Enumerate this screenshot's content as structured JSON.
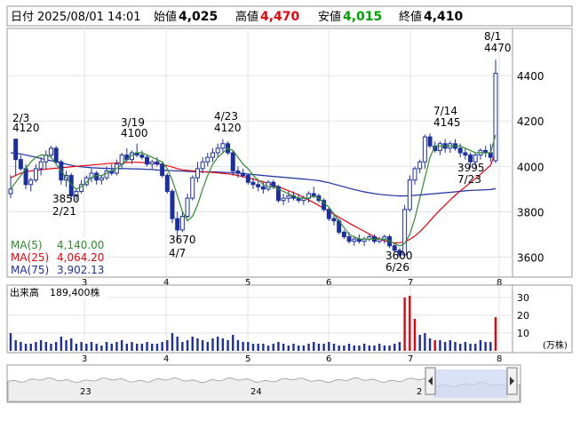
{
  "header": {
    "date_label": "日付",
    "date_value": "2025/08/01 14:01",
    "open_label": "始値",
    "open_value": "4,025",
    "high_label": "高値",
    "high_value": "4,470",
    "low_label": "安値",
    "low_value": "4,015",
    "close_label": "終値",
    "close_value": "4,410",
    "high_color": "#e8000b",
    "low_color": "#00a000"
  },
  "chart_data": [
    {
      "type": "candlestick",
      "ylim": [
        3520,
        4600
      ],
      "ticks": [
        3600,
        3800,
        4000,
        4200,
        4400
      ],
      "x_tick_labels": [
        "3",
        "4",
        "5",
        "6",
        "7",
        "8"
      ],
      "colors": {
        "up": "#ffffff",
        "down": "#1b2fa0",
        "ma5": "#2e8b2e",
        "ma25": "#e8000b",
        "ma75": "#1b2fa0"
      },
      "ohlc": [
        [
          3880,
          3860,
          3960,
          3900
        ],
        [
          4120,
          3960,
          4120,
          4030
        ],
        [
          4030,
          3980,
          4050,
          3990
        ],
        [
          3990,
          3900,
          4010,
          3920
        ],
        [
          3920,
          3890,
          3950,
          3940
        ],
        [
          3940,
          3930,
          4010,
          3990
        ],
        [
          3990,
          3960,
          4040,
          4020
        ],
        [
          4020,
          3990,
          4070,
          4050
        ],
        [
          4050,
          4040,
          4090,
          4080
        ],
        [
          4080,
          4010,
          4090,
          4020
        ],
        [
          4020,
          3920,
          4030,
          3940
        ],
        [
          3940,
          3910,
          3980,
          3960
        ],
        [
          3960,
          3850,
          3970,
          3870
        ],
        [
          3870,
          3850,
          3900,
          3890
        ],
        [
          3890,
          3880,
          3940,
          3920
        ],
        [
          3920,
          3910,
          3960,
          3950
        ],
        [
          3950,
          3930,
          3990,
          3970
        ],
        [
          3970,
          3920,
          3980,
          3940
        ],
        [
          3940,
          3920,
          3960,
          3950
        ],
        [
          3950,
          3940,
          4000,
          3980
        ],
        [
          3980,
          3960,
          4010,
          3970
        ],
        [
          3970,
          3960,
          4030,
          4010
        ],
        [
          4010,
          3990,
          4060,
          4050
        ],
        [
          4050,
          4020,
          4080,
          4030
        ],
        [
          4030,
          4010,
          4070,
          4060
        ],
        [
          4060,
          4040,
          4100,
          4050
        ],
        [
          4050,
          4030,
          4070,
          4040
        ],
        [
          4040,
          4000,
          4050,
          4010
        ],
        [
          4010,
          3990,
          4030,
          4020
        ],
        [
          4020,
          4000,
          4040,
          4010
        ],
        [
          4010,
          3950,
          4020,
          3960
        ],
        [
          3960,
          3880,
          3970,
          3890
        ],
        [
          3890,
          3750,
          3900,
          3770
        ],
        [
          3770,
          3670,
          3800,
          3720
        ],
        [
          3720,
          3710,
          3800,
          3780
        ],
        [
          3780,
          3770,
          3880,
          3860
        ],
        [
          3860,
          3850,
          3960,
          3950
        ],
        [
          3950,
          3930,
          4020,
          3990
        ],
        [
          3990,
          3970,
          4040,
          4020
        ],
        [
          4020,
          4000,
          4060,
          4040
        ],
        [
          4040,
          4020,
          4080,
          4060
        ],
        [
          4060,
          4040,
          4100,
          4080
        ],
        [
          4080,
          4060,
          4120,
          4100
        ],
        [
          4100,
          4050,
          4110,
          4060
        ],
        [
          4060,
          3960,
          4070,
          3980
        ],
        [
          3980,
          3950,
          4000,
          3970
        ],
        [
          3970,
          3950,
          3990,
          3960
        ],
        [
          3960,
          3920,
          3970,
          3930
        ],
        [
          3930,
          3900,
          3950,
          3920
        ],
        [
          3920,
          3890,
          3940,
          3910
        ],
        [
          3910,
          3880,
          3930,
          3900
        ],
        [
          3900,
          3890,
          3940,
          3930
        ],
        [
          3930,
          3900,
          3940,
          3910
        ],
        [
          3910,
          3840,
          3920,
          3850
        ],
        [
          3850,
          3830,
          3880,
          3860
        ],
        [
          3860,
          3840,
          3890,
          3870
        ],
        [
          3870,
          3850,
          3890,
          3860
        ],
        [
          3860,
          3840,
          3880,
          3850
        ],
        [
          3850,
          3830,
          3870,
          3860
        ],
        [
          3860,
          3840,
          3890,
          3880
        ],
        [
          3880,
          3860,
          3910,
          3870
        ],
        [
          3870,
          3840,
          3880,
          3850
        ],
        [
          3850,
          3800,
          3860,
          3810
        ],
        [
          3810,
          3760,
          3820,
          3770
        ],
        [
          3770,
          3740,
          3790,
          3760
        ],
        [
          3760,
          3700,
          3770,
          3710
        ],
        [
          3710,
          3680,
          3720,
          3690
        ],
        [
          3690,
          3660,
          3710,
          3670
        ],
        [
          3670,
          3650,
          3690,
          3680
        ],
        [
          3680,
          3660,
          3700,
          3670
        ],
        [
          3670,
          3650,
          3690,
          3680
        ],
        [
          3680,
          3670,
          3700,
          3690
        ],
        [
          3690,
          3660,
          3700,
          3670
        ],
        [
          3670,
          3660,
          3690,
          3680
        ],
        [
          3680,
          3660,
          3700,
          3690
        ],
        [
          3690,
          3640,
          3700,
          3650
        ],
        [
          3650,
          3620,
          3660,
          3630
        ],
        [
          3630,
          3600,
          3640,
          3610
        ],
        [
          3610,
          3600,
          3830,
          3810
        ],
        [
          3810,
          3800,
          3960,
          3940
        ],
        [
          3940,
          3920,
          4000,
          3990
        ],
        [
          3990,
          3970,
          4030,
          4020
        ],
        [
          4020,
          3990,
          4140,
          4130
        ],
        [
          4130,
          4080,
          4145,
          4090
        ],
        [
          4090,
          4060,
          4110,
          4070
        ],
        [
          4070,
          4050,
          4110,
          4100
        ],
        [
          4100,
          4060,
          4120,
          4080
        ],
        [
          4080,
          4060,
          4110,
          4100
        ],
        [
          4100,
          4070,
          4120,
          4080
        ],
        [
          4080,
          4040,
          4100,
          4060
        ],
        [
          4060,
          4030,
          4080,
          4050
        ],
        [
          4050,
          3995,
          4060,
          4020
        ],
        [
          4020,
          4000,
          4060,
          4050
        ],
        [
          4050,
          4030,
          4080,
          4070
        ],
        [
          4070,
          4040,
          4090,
          4060
        ],
        [
          4060,
          4020,
          4100,
          4040
        ],
        [
          4025,
          4015,
          4470,
          4410
        ]
      ],
      "ma5": [
        3900,
        3930,
        3960,
        3990,
        4020,
        4040,
        4050,
        4050,
        4040,
        4010,
        3980,
        3950,
        3920,
        3900,
        3910,
        3930,
        3950,
        3960,
        3960,
        3970,
        3980,
        3990,
        4010,
        4030,
        4050,
        4060,
        4060,
        4050,
        4040,
        4030,
        4020,
        3990,
        3940,
        3870,
        3800,
        3760,
        3780,
        3830,
        3900,
        3960,
        4010,
        4040,
        4060,
        4080,
        4070,
        4040,
        4010,
        3990,
        3960,
        3940,
        3920,
        3910,
        3910,
        3900,
        3890,
        3880,
        3870,
        3860,
        3860,
        3860,
        3870,
        3860,
        3840,
        3820,
        3790,
        3760,
        3730,
        3700,
        3690,
        3680,
        3680,
        3680,
        3680,
        3680,
        3680,
        3670,
        3660,
        3650,
        3660,
        3700,
        3770,
        3860,
        3950,
        4040,
        4090,
        4090,
        4090,
        4090,
        4090,
        4090,
        4080,
        4070,
        4060,
        4060,
        4060,
        4060,
        4140
      ],
      "ma25": [
        3950,
        3960,
        3970,
        3975,
        3980,
        3982,
        3985,
        3988,
        3990,
        3992,
        3994,
        3996,
        3998,
        4000,
        4002,
        4004,
        4006,
        4008,
        4010,
        4012,
        4014,
        4015,
        4016,
        4017,
        4018,
        4018,
        4017,
        4016,
        4015,
        4012,
        4008,
        4003,
        3997,
        3990,
        3985,
        3982,
        3980,
        3978,
        3976,
        3975,
        3973,
        3971,
        3969,
        3967,
        3964,
        3960,
        3955,
        3950,
        3944,
        3938,
        3932,
        3925,
        3918,
        3910,
        3902,
        3893,
        3884,
        3874,
        3863,
        3852,
        3840,
        3828,
        3815,
        3802,
        3789,
        3776,
        3763,
        3750,
        3738,
        3726,
        3714,
        3702,
        3690,
        3680,
        3672,
        3666,
        3663,
        3664,
        3668,
        3678,
        3693,
        3712,
        3735,
        3760,
        3785,
        3808,
        3830,
        3852,
        3872,
        3892,
        3910,
        3928,
        3946,
        3965,
        3985,
        4005,
        4064
      ],
      "ma75": [
        4060,
        4058,
        4055,
        4050,
        4045,
        4040,
        4035,
        4030,
        4025,
        4020,
        4015,
        4010,
        4005,
        4000,
        3998,
        3996,
        3994,
        3993,
        3992,
        3991,
        3990,
        3990,
        3990,
        3990,
        3989,
        3989,
        3988,
        3987,
        3986,
        3984,
        3983,
        3982,
        3981,
        3980,
        3979,
        3978,
        3977,
        3976,
        3976,
        3976,
        3976,
        3975,
        3974,
        3973,
        3972,
        3970,
        3968,
        3966,
        3964,
        3962,
        3960,
        3958,
        3956,
        3954,
        3952,
        3950,
        3948,
        3946,
        3944,
        3942,
        3940,
        3937,
        3933,
        3928,
        3922,
        3916,
        3910,
        3904,
        3898,
        3893,
        3888,
        3884,
        3880,
        3877,
        3875,
        3873,
        3871,
        3870,
        3870,
        3871,
        3872,
        3874,
        3876,
        3878,
        3880,
        3882,
        3884,
        3886,
        3888,
        3890,
        3892,
        3894,
        3895,
        3896,
        3897,
        3898,
        3902
      ],
      "annotations": [
        {
          "date": "2/3",
          "value": "4120"
        },
        {
          "date": "2/21",
          "value": "3850"
        },
        {
          "date": "3/19",
          "value": "4100"
        },
        {
          "date": "4/7",
          "value": "3670"
        },
        {
          "date": "4/23",
          "value": "4120"
        },
        {
          "date": "6/26",
          "value": "3600"
        },
        {
          "date": "7/14",
          "value": "4145"
        },
        {
          "date": "7/23",
          "value": "3995"
        },
        {
          "date": "8/1",
          "value": "4470"
        }
      ],
      "legend": [
        {
          "label": "MA(5)",
          "value": "4,140.00",
          "color": "#2e8b2e"
        },
        {
          "label": "MA(25)",
          "value": "4,064.20",
          "color": "#e8000b"
        },
        {
          "label": "MA(75)",
          "value": "3,902.13",
          "color": "#1b2fa0"
        }
      ]
    },
    {
      "type": "bar",
      "title": "出来高",
      "value_label": "189,400株",
      "unit_label": "(万株)",
      "ticks": [
        10,
        20,
        30
      ],
      "ylim": [
        0,
        36
      ],
      "x_tick_labels": [
        "3",
        "4",
        "5",
        "6",
        "7",
        "8"
      ],
      "values": [
        10,
        6,
        5,
        4,
        4,
        5,
        6,
        5,
        4,
        5,
        8,
        6,
        7,
        4,
        5,
        4,
        5,
        4,
        3,
        5,
        4,
        5,
        6,
        4,
        5,
        4,
        4,
        5,
        4,
        4,
        5,
        6,
        10,
        8,
        5,
        6,
        8,
        7,
        6,
        5,
        7,
        8,
        7,
        6,
        9,
        6,
        5,
        5,
        4,
        4,
        4,
        3,
        4,
        5,
        4,
        3,
        4,
        3,
        3,
        4,
        5,
        4,
        4,
        5,
        4,
        3,
        3,
        4,
        3,
        3,
        4,
        3,
        3,
        4,
        3,
        3,
        4,
        5,
        30,
        31,
        18,
        9,
        10,
        7,
        6,
        6,
        5,
        6,
        5,
        4,
        5,
        4,
        4,
        6,
        5,
        5,
        19
      ],
      "highlight_indices": [
        78,
        79,
        80,
        84,
        96
      ],
      "colors": {
        "normal": "#1b2fa0",
        "highlight": "#e8000b"
      }
    },
    {
      "type": "area",
      "label_left": "23",
      "label_mid": "24",
      "label_right": "2"
    }
  ]
}
